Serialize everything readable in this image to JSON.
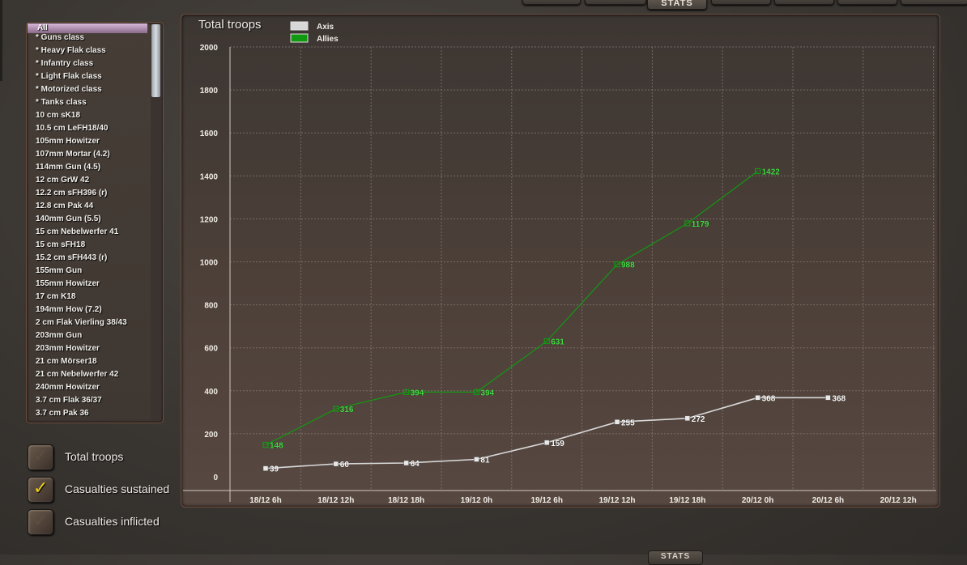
{
  "top_tabs": [
    {
      "label": ""
    },
    {
      "label": ""
    },
    {
      "label": "STATS",
      "active": true
    },
    {
      "label": ""
    },
    {
      "label": ""
    },
    {
      "label": ""
    },
    {
      "label": ""
    }
  ],
  "bottom_tab": {
    "label": "STATS"
  },
  "unit_list": {
    "selected_index": 0,
    "items": [
      "All",
      "* Guns class",
      "* Heavy Flak class",
      "* Infantry class",
      "* Light Flak class",
      "* Motorized class",
      "* Tanks class",
      "10 cm sK18",
      "10.5 cm LeFH18/40",
      "105mm Howitzer",
      "107mm Mortar (4.2)",
      "114mm Gun (4.5)",
      "12 cm GrW 42",
      "12.2 cm sFH396 (r)",
      "12.8 cm Pak 44",
      "140mm Gun (5.5)",
      "15 cm Nebelwerfer 41",
      "15 cm sFH18",
      "15.2 cm sFH443 (r)",
      "155mm Gun",
      "155mm Howitzer",
      "17 cm K18",
      "194mm How (7.2)",
      "2 cm Flak Vierling 38/43",
      "203mm Gun",
      "203mm Howitzer",
      "21 cm Mörser18",
      "21 cm Nebelwerfer 42",
      "240mm Howitzer",
      "3.7 cm Flak 36/37",
      "3.7 cm Pak 36"
    ]
  },
  "stat_toggles": [
    {
      "label": "Total troops",
      "checked": false
    },
    {
      "label": "Casualties sustained",
      "checked": true
    },
    {
      "label": "Casualties inflicted",
      "checked": false
    }
  ],
  "chart_data": {
    "type": "line",
    "title": "Total troops",
    "xlabel": "",
    "ylabel": "",
    "categories": [
      "18/12 6h",
      "18/12 12h",
      "18/12 18h",
      "19/12 0h",
      "19/12 6h",
      "19/12 12h",
      "19/12 18h",
      "20/12 0h",
      "20/12 6h",
      "20/12 12h"
    ],
    "ylim": [
      0,
      2000
    ],
    "yticks": [
      0,
      200,
      400,
      600,
      800,
      1000,
      1200,
      1400,
      1600,
      1800,
      2000
    ],
    "grid": true,
    "legend_position": "top-left",
    "series": [
      {
        "name": "Axis",
        "color": "#d8d8d8",
        "values": [
          39,
          60,
          64,
          81,
          159,
          255,
          272,
          368,
          368,
          null
        ]
      },
      {
        "name": "Allies",
        "color": "#119911",
        "values": [
          148,
          316,
          394,
          394,
          631,
          988,
          1179,
          1422,
          null,
          null
        ]
      }
    ]
  }
}
